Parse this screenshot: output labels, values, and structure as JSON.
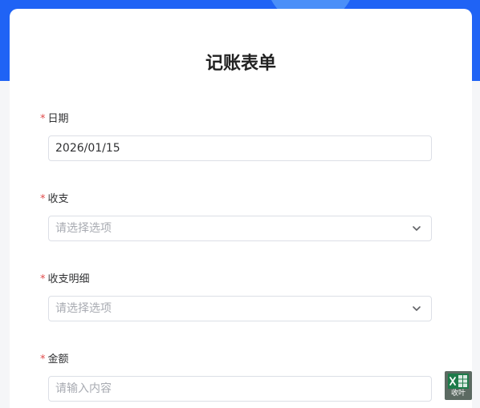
{
  "form": {
    "title": "记账表单",
    "fields": [
      {
        "required_mark": "*",
        "label": "日期",
        "type": "date",
        "value": "2026/01/15"
      },
      {
        "required_mark": "*",
        "label": "收支",
        "type": "select",
        "placeholder": "请选择选项",
        "icon": "chevron-down-icon"
      },
      {
        "required_mark": "*",
        "label": "收支明细",
        "type": "select",
        "placeholder": "请选择选项",
        "icon": "chevron-down-icon"
      },
      {
        "required_mark": "*",
        "label": "金额",
        "type": "text",
        "placeholder": "请输入内容"
      }
    ]
  },
  "badge": {
    "icon": "excel-icon",
    "text": "收叶"
  },
  "colors": {
    "header_blue": "#1f63f5",
    "required_red": "#e14b4b",
    "badge_green": "#1e7b4a"
  }
}
